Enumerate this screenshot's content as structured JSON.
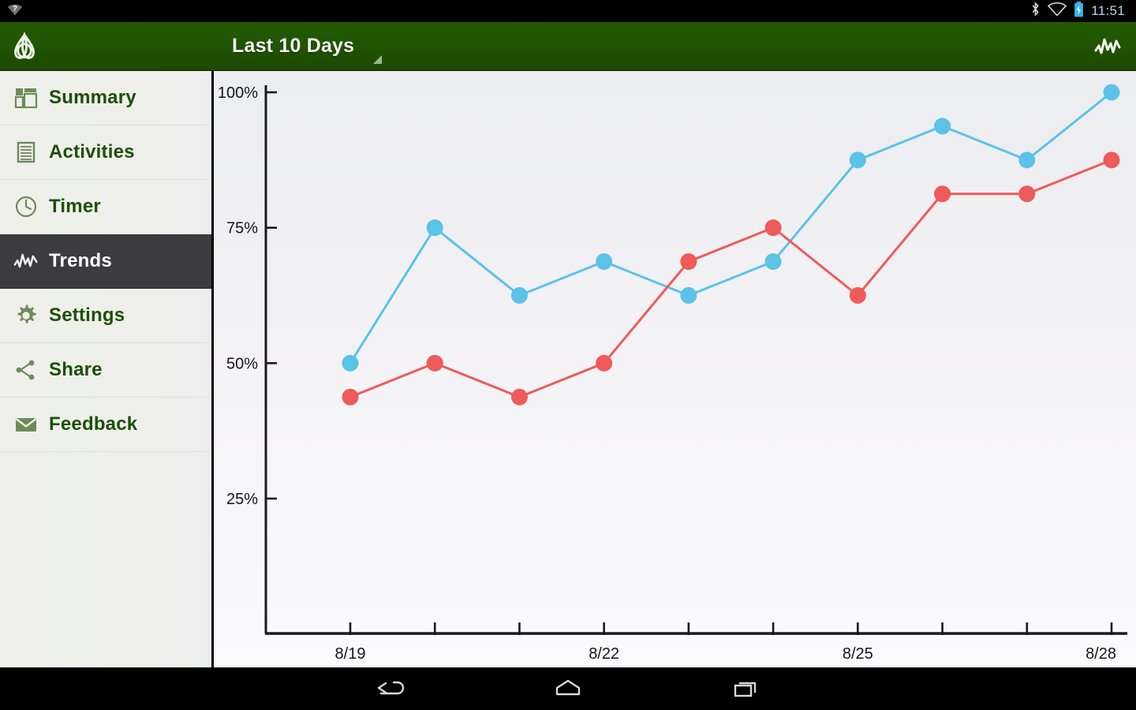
{
  "status_bar": {
    "time": "11:51",
    "icons": [
      "wifi-unknown-icon",
      "bluetooth-icon",
      "wifi-icon",
      "battery-charging-icon"
    ]
  },
  "action_bar": {
    "logo": "triquetra-logo-icon",
    "title": "Last 10 Days",
    "spinner_caret": "dropdown-caret-icon",
    "action_icon": "trends-waveform-icon"
  },
  "sidebar": {
    "items": [
      {
        "label": "Summary",
        "icon": "dashboard-icon",
        "active": false
      },
      {
        "label": "Activities",
        "icon": "list-icon",
        "active": false
      },
      {
        "label": "Timer",
        "icon": "clock-icon",
        "active": false
      },
      {
        "label": "Trends",
        "icon": "waveform-icon",
        "active": true
      },
      {
        "label": "Settings",
        "icon": "gear-icon",
        "active": false
      },
      {
        "label": "Share",
        "icon": "share-icon",
        "active": false
      },
      {
        "label": "Feedback",
        "icon": "envelope-icon",
        "active": false
      }
    ]
  },
  "nav_bar": {
    "buttons": [
      {
        "label": "Back",
        "icon": "back-arrow-icon"
      },
      {
        "label": "Home",
        "icon": "home-icon"
      },
      {
        "label": "Recents",
        "icon": "recents-icon"
      }
    ]
  },
  "colors": {
    "accent_green": "#1f5202",
    "series_blue": "#5bc2e8",
    "series_red": "#ef5a5a",
    "sidebar_active": "#3c3c3e",
    "label_green": "#1d4f06"
  },
  "chart_data": {
    "type": "line",
    "title": "Last 10 Days",
    "xlabel": "",
    "ylabel": "",
    "grid": false,
    "legend_position": "none",
    "x": [
      "8/19",
      "8/20",
      "8/21",
      "8/22",
      "8/23",
      "8/24",
      "8/25",
      "8/26",
      "8/27",
      "8/28"
    ],
    "xtick_labels": [
      "8/19",
      "",
      "",
      "8/22",
      "",
      "",
      "8/25",
      "",
      "",
      "8/28"
    ],
    "ytick_labels": [
      "25%",
      "50%",
      "75%",
      "100%"
    ],
    "yticks": [
      25,
      50,
      75,
      100
    ],
    "ylim": [
      0,
      100
    ],
    "series": [
      {
        "name": "blue-series",
        "color": "#5bc2e8",
        "values": [
          50,
          75,
          62.5,
          68.75,
          62.5,
          68.75,
          87.5,
          93.75,
          87.5,
          100
        ]
      },
      {
        "name": "red-series",
        "color": "#ef5a5a",
        "values": [
          43.75,
          50,
          43.75,
          50,
          68.75,
          75,
          62.5,
          81.25,
          81.25,
          87.5
        ]
      }
    ]
  }
}
